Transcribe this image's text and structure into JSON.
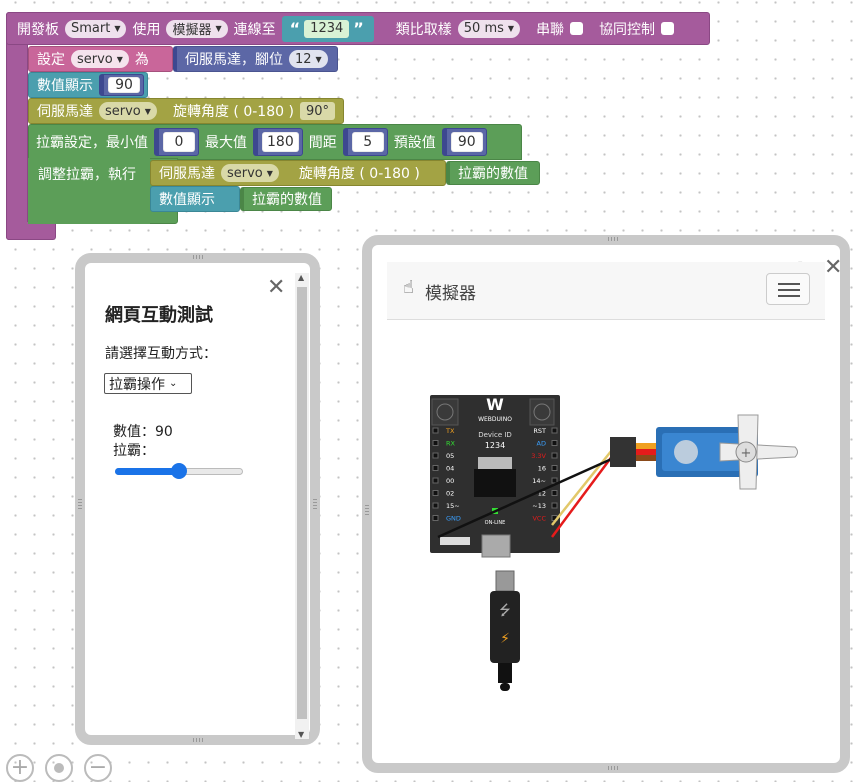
{
  "toolbar_block": {
    "board_label": "開發板",
    "board_value": "Smart",
    "use_label": "使用",
    "mode_value": "模擬器",
    "connect_label": "連線至",
    "device_id": "1234",
    "sample_label": "類比取樣",
    "sample_value": "50 ms",
    "serial_label": "串聯",
    "coop_label": "協同控制"
  },
  "blocks": {
    "set_label": "設定",
    "set_var": "servo",
    "as_label": "為",
    "servo_pin_label": "伺服馬達，腳位",
    "servo_pin": "12",
    "display_label": "數值顯示",
    "display_value": "90",
    "servo_label": "伺服馬達",
    "servo_var": "servo",
    "rotate_label": "旋轉角度 ( 0-180 )",
    "rotate_value": "90°",
    "slider_set_label": "拉霸設定，最小值",
    "min_value": "0",
    "max_label": "最大值",
    "max_value": "180",
    "step_label": "間距",
    "step_value": "5",
    "default_label": "預設值",
    "default_value": "90",
    "adjust_label": "調整拉霸，執行",
    "inner_servo_label": "伺服馬達",
    "inner_servo_var": "servo",
    "inner_rotate_label": "旋轉角度 ( 0-180 )",
    "slider_value_label": "拉霸的數值",
    "inner_display_label": "數值顯示",
    "inner_slider_value_label": "拉霸的數值"
  },
  "test_panel": {
    "title": "網頁互動測試",
    "prompt": "請選擇互動方式：",
    "select_value": "拉霸操作",
    "value_line": "數值：90",
    "slider_label": "拉霸：",
    "slider_fraction": 0.5
  },
  "sim_panel": {
    "title": "模擬器",
    "board_brand": "WEBDUINO",
    "device_id_label": "Device ID",
    "device_id": "1234",
    "pins_left": [
      "TX",
      "RX",
      "05",
      "04",
      "00",
      "02",
      "15~",
      "GND"
    ],
    "pins_right": [
      "RST",
      "AD",
      "3.3V",
      "16",
      "14~",
      "~12",
      "~13",
      "VCC"
    ],
    "online_label": "ON-LINE"
  },
  "icons": {
    "close": "close-icon",
    "expand": "expand-icon",
    "menu": "hamburger-menu-icon",
    "pointer": "hand-pointer-icon",
    "zoom_in": "zoom-in-icon",
    "zoom_reset": "zoom-reset-icon",
    "zoom_out": "zoom-out-icon"
  },
  "colors": {
    "board_block": "#a55b9c",
    "variable_block": "#c9669a",
    "servo_block": "#a3a344",
    "slider_block": "#5c9e58",
    "number_block": "#5c67a6"
  }
}
